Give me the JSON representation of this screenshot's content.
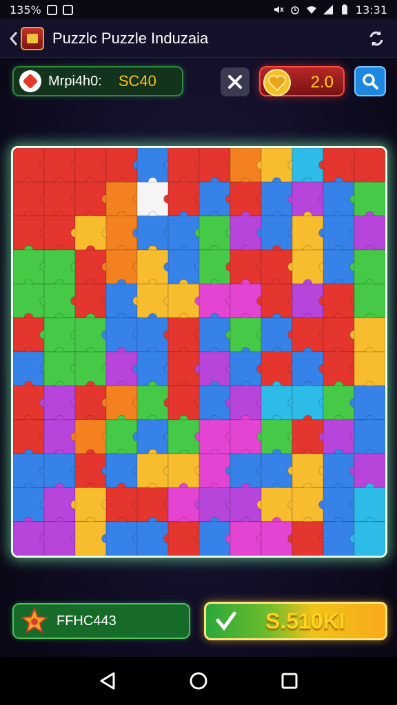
{
  "status_bar": {
    "battery_text": "135%",
    "time": "13:31",
    "icons": [
      "notification-box-icon",
      "notification-box-icon",
      "mute-icon",
      "alarm-icon",
      "wifi-icon",
      "signal-icon",
      "battery-icon"
    ]
  },
  "header": {
    "title": "Puzzlc Puzzle Induzaia",
    "icons": [
      "back-arrow-icon",
      "app-logo-icon",
      "refresh-icon"
    ]
  },
  "top_bar": {
    "score_label": "Mrpi4h0:",
    "score_value": "SC40",
    "lives_value": "2.0",
    "icons": [
      "puzzle-piece-icon",
      "close-icon",
      "heart-icon",
      "search-icon"
    ]
  },
  "puzzle": {
    "rows": 12,
    "cols": 12,
    "palette": {
      "R": "#e32a22",
      "O": "#f47a12",
      "Y": "#f8b822",
      "G": "#3ac63c",
      "B": "#2a7be8",
      "C": "#20b7e6",
      "P": "#b33ad9",
      "M": "#e239d0",
      "W": "#f5f5f5"
    },
    "grid": [
      "RRRRBRROYCRR",
      "RRROWRBRBPBG",
      "RRYOBBGPBYBP",
      "GGROYBGRRYBG",
      "GGRBYYMMRPRG",
      "RGGBBRBGBRRY",
      "BGGPBRPBRBRY",
      "RPROGRBPCCGB",
      "RPOGBGMMGRPB",
      "BBRBYYMBBYBP",
      "BPYRRMPPYYBC",
      "PPYBBRBMMRBC"
    ]
  },
  "bottom_bar": {
    "level_text": "FFHC443",
    "coins_text": "S.510KI",
    "icons": [
      "star-icon",
      "check-icon"
    ]
  },
  "nav_bar": {
    "icons": [
      "back-triangle-icon",
      "home-circle-icon",
      "recents-square-icon"
    ]
  }
}
